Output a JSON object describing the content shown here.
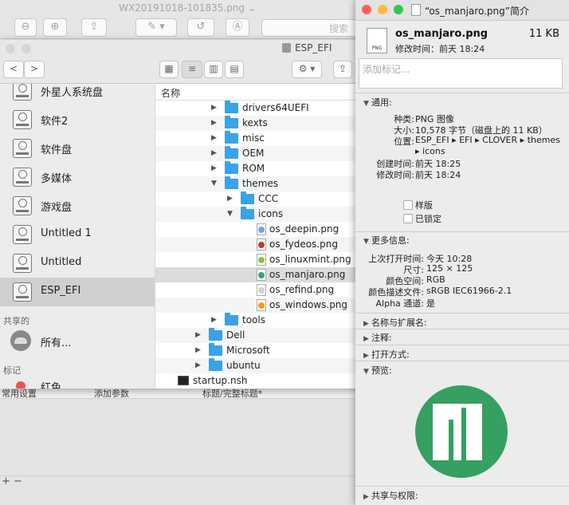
{
  "bg_window": {
    "title": "WX20191018-101835.png ⌄",
    "search_placeholder": "搜索",
    "strip": [
      "常用设置",
      "添加参数",
      "标题/完整标题*"
    ],
    "plus_minus": "+ −"
  },
  "finder": {
    "title": "ESP_EFI",
    "nav_back": "<",
    "nav_forward": ">",
    "sidebar": {
      "devices": [
        {
          "label": "外星人系统盘",
          "selected": false
        },
        {
          "label": "软件2",
          "selected": false
        },
        {
          "label": "软件盘",
          "selected": false
        },
        {
          "label": "多媒体",
          "selected": false
        },
        {
          "label": "游戏盘",
          "selected": false
        },
        {
          "label": "Untitled 1",
          "selected": false
        },
        {
          "label": "Untitled",
          "selected": false
        },
        {
          "label": "ESP_EFI",
          "selected": true
        }
      ],
      "shared_header": "共享的",
      "shared_items": [
        {
          "label": "所有..."
        }
      ],
      "tags_header": "标记",
      "tags_items": [
        {
          "label": "红色"
        }
      ]
    },
    "column_header": "名称",
    "rows": [
      {
        "label": "drivers64UEFI",
        "type": "folder",
        "depth": 2,
        "expanded": false
      },
      {
        "label": "kexts",
        "type": "folder",
        "depth": 2,
        "expanded": false
      },
      {
        "label": "misc",
        "type": "folder",
        "depth": 2,
        "expanded": false
      },
      {
        "label": "OEM",
        "type": "folder",
        "depth": 2,
        "expanded": false
      },
      {
        "label": "ROM",
        "type": "folder",
        "depth": 2,
        "expanded": false
      },
      {
        "label": "themes",
        "type": "folder",
        "depth": 2,
        "expanded": true
      },
      {
        "label": "CCC",
        "type": "folder",
        "depth": 3,
        "expanded": false
      },
      {
        "label": "icons",
        "type": "folder",
        "depth": 3,
        "expanded": true
      },
      {
        "label": "os_deepin.png",
        "type": "png",
        "depth": 4,
        "color": "#6fa8dc"
      },
      {
        "label": "os_fydeos.png",
        "type": "png",
        "depth": 4,
        "color": "#c0392b"
      },
      {
        "label": "os_linuxmint.png",
        "type": "png",
        "depth": 4,
        "color": "#8bc34a"
      },
      {
        "label": "os_manjaro.png",
        "type": "png",
        "depth": 4,
        "color": "#35a772",
        "selected": true
      },
      {
        "label": "os_refind.png",
        "type": "png",
        "depth": 4,
        "color": "#d0d0d0"
      },
      {
        "label": "os_windows.png",
        "type": "png",
        "depth": 4,
        "color": "#f39c12"
      },
      {
        "label": "tools",
        "type": "folder",
        "depth": 2,
        "expanded": false
      },
      {
        "label": "Dell",
        "type": "folder",
        "depth": 1,
        "expanded": false
      },
      {
        "label": "Microsoft",
        "type": "folder",
        "depth": 1,
        "expanded": false
      },
      {
        "label": "ubuntu",
        "type": "folder",
        "depth": 1,
        "expanded": false
      },
      {
        "label": "startup.nsh",
        "type": "terminal",
        "depth": 0
      }
    ]
  },
  "info": {
    "title": "“os_manjaro.png”简介",
    "png_badge": "PNG",
    "file_name": "os_manjaro.png",
    "file_size": "11 KB",
    "modified_line": "修改时间：前天 18:24",
    "tags_placeholder": "添加标记...",
    "general": {
      "header": "通用:",
      "kind_label": "种类:",
      "kind": "PNG 图像",
      "size_label": "大小:",
      "size": "10,578 字节（磁盘上的 11 KB）",
      "where_label": "位置:",
      "where_line1": "ESP_EFI ▸ EFI ▸ CLOVER ▸ themes",
      "where_line2": "▸ icons",
      "created_label": "创建时间:",
      "created": "前天 18:25",
      "modified_label": "修改时间:",
      "modified": "前天 18:24",
      "stationery_label": "样版",
      "locked_label": "已锁定"
    },
    "more_info": {
      "header": "更多信息:",
      "last_opened_label": "上次打开时间:",
      "last_opened": "今天 10:28",
      "dimensions_label": "尺寸:",
      "dimensions": "125 × 125",
      "color_space_label": "颜色空间:",
      "color_space": "RGB",
      "color_profile_label": "颜色描述文件:",
      "color_profile": "sRGB IEC61966-2.1",
      "alpha_label": "Alpha 通道:",
      "alpha": "是"
    },
    "name_ext": "名称与扩展名:",
    "comments": "注释:",
    "open_with": "打开方式:",
    "preview_header": "预览:",
    "sharing": "共享与权限:",
    "colors": {
      "manjaro_green": "#35a060",
      "close": "#fc605c",
      "minimize": "#fdbc40",
      "zoom": "#34c84a"
    }
  }
}
